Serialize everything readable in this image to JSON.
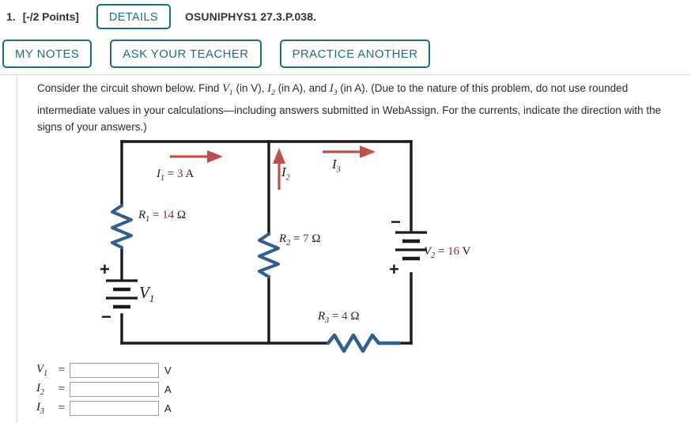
{
  "header": {
    "question_number": "1.",
    "points_label": "[-/2 Points]",
    "details_label": "DETAILS",
    "assignment_code": "OSUNIPHYS1 27.3.P.038."
  },
  "tools": {
    "my_notes_label": "MY NOTES",
    "ask_teacher_label": "ASK YOUR TEACHER",
    "practice_another_label": "PRACTICE ANOTHER"
  },
  "question": {
    "line1_a": "Consider the circuit shown below. Find ",
    "var_v": "V",
    "var_v_sub": "1",
    "line1_b": " (in V), ",
    "var_i2": "I",
    "var_i2_sub": "2",
    "line1_c": " (in A), and ",
    "var_i3": "I",
    "var_i3_sub": "3",
    "line1_d": " (in A). (Due to the nature of this problem, do not use rounded intermediate values in your calculations—including answers submitted in WebAssign. For the currents, indicate the direction with the signs of your answers.)"
  },
  "circuit": {
    "i1": {
      "symbol": "I",
      "sub": "1",
      "eq": " = ",
      "value": "3",
      "unit": " A"
    },
    "i2": {
      "symbol": "I",
      "sub": "2"
    },
    "i3": {
      "symbol": "I",
      "sub": "3"
    },
    "r1": {
      "symbol": "R",
      "sub": "1",
      "eq": " = ",
      "value": "14",
      "unit": " Ω"
    },
    "r2": {
      "symbol": "R",
      "sub": "2",
      "eq": " = ",
      "value": "7",
      "unit": " Ω"
    },
    "r3": {
      "symbol": "R",
      "sub": "3",
      "eq": " = ",
      "value": "4",
      "unit": " Ω"
    },
    "v1": {
      "symbol": "V",
      "sub": "1"
    },
    "v2": {
      "symbol": "V",
      "sub": "2",
      "eq": " = ",
      "value": "16",
      "unit": " V"
    },
    "battery1_plus": "+",
    "battery1_minus": "−",
    "battery2_plus": "+",
    "battery2_minus": "−",
    "colors": {
      "wire": "#1a1a1a",
      "resistor": "#2e5f8f",
      "arrow": "#c0504d",
      "value_text": "#b32222"
    }
  },
  "answers": {
    "rows": [
      {
        "symbol": "V",
        "sub": "1",
        "eq": "=",
        "value": "",
        "unit": "V"
      },
      {
        "symbol": "I",
        "sub": "2",
        "eq": "=",
        "value": "",
        "unit": "A"
      },
      {
        "symbol": "I",
        "sub": "3",
        "eq": "=",
        "value": "",
        "unit": "A"
      }
    ]
  }
}
